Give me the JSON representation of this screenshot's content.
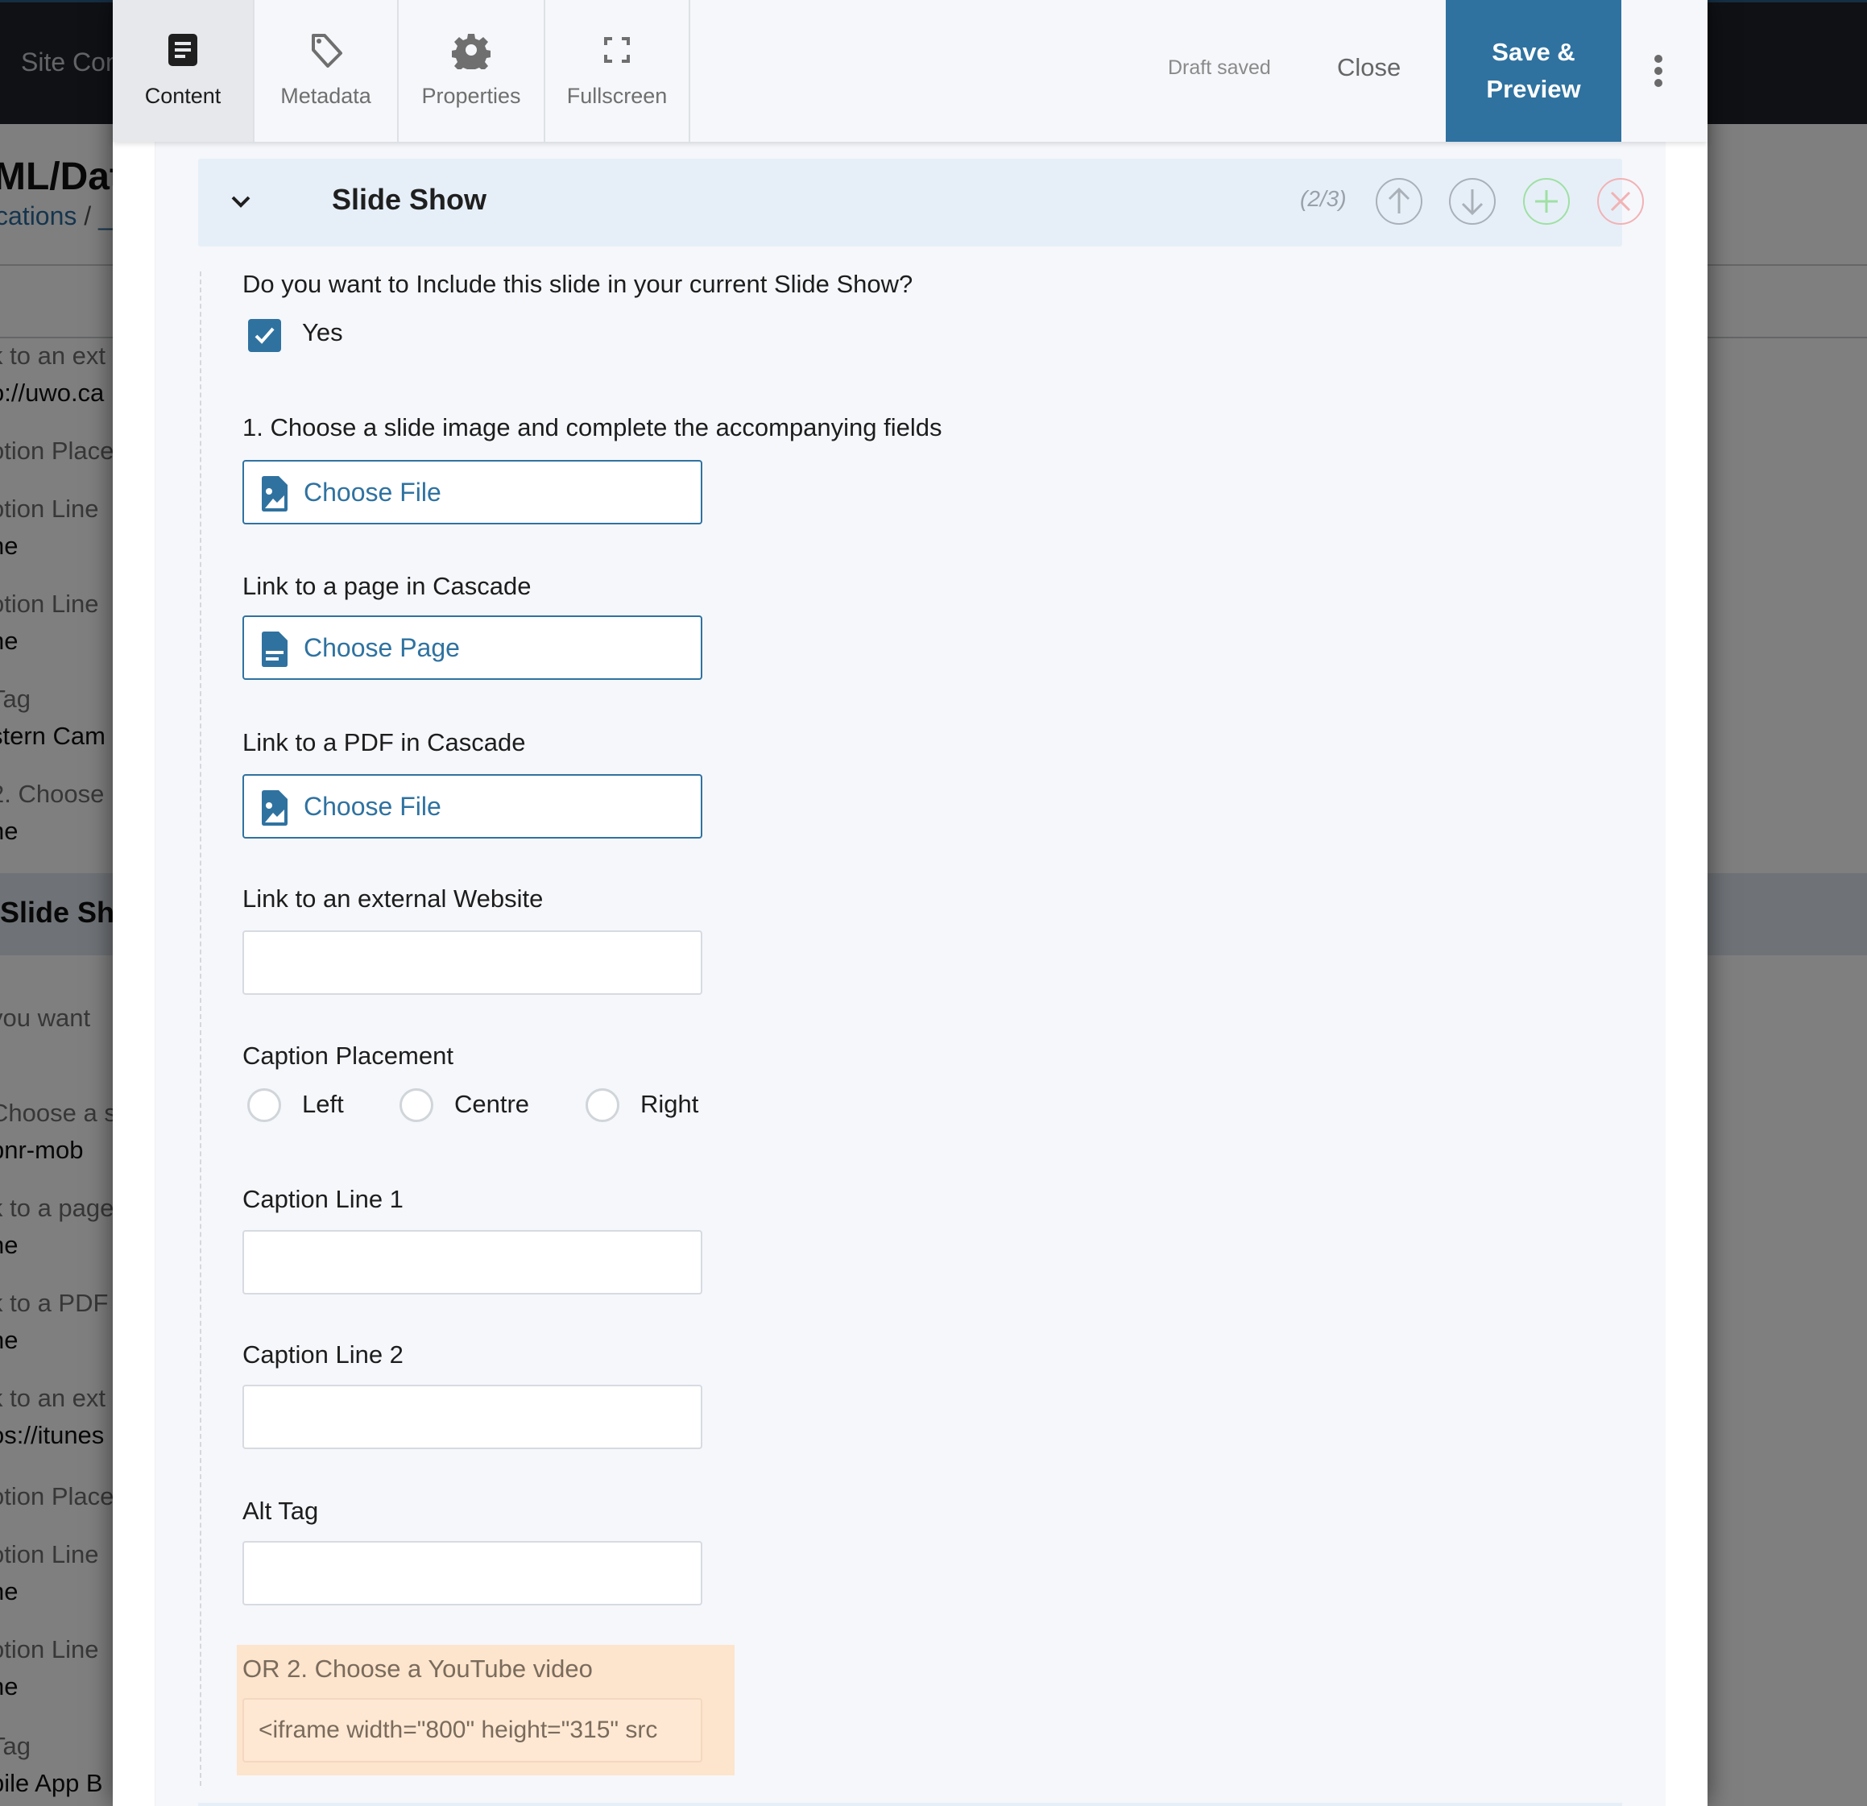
{
  "background_page": {
    "nav_label": "Site Con",
    "title": "ML/Dat",
    "breadcrumb": [
      "cations",
      "/",
      "_"
    ],
    "fields": [
      {
        "label": "k to an ext",
        "value": "o://uwo.ca"
      },
      {
        "label": "otion Place",
        "value": ""
      },
      {
        "label": "otion Line",
        "value": "ne"
      },
      {
        "label": "otion Line",
        "value": "ne"
      },
      {
        "label": "Tag",
        "value": "stern Cam"
      },
      {
        "label": "2. Choose",
        "value": "ne"
      }
    ],
    "section_title": "Slide Sho",
    "fields_2": [
      {
        "label": "you want",
        "value": ""
      },
      {
        "label": "Choose a s",
        "value": "bnr-mob"
      },
      {
        "label": "k to a page",
        "value": "ne"
      },
      {
        "label": "k to a PDF",
        "value": "ne"
      },
      {
        "label": "k to an ext",
        "value": "os://itunes"
      },
      {
        "label": "otion Place",
        "value": ""
      },
      {
        "label": "otion Line",
        "value": "ne"
      },
      {
        "label": "otion Line",
        "value": "ne"
      },
      {
        "label": "Tag",
        "value": "bile App B"
      }
    ]
  },
  "toolbar": {
    "tabs": [
      {
        "label": "Content",
        "icon": "content-icon",
        "active": true
      },
      {
        "label": "Metadata",
        "icon": "tag-icon",
        "active": false
      },
      {
        "label": "Properties",
        "icon": "gear-icon",
        "active": false
      },
      {
        "label": "Fullscreen",
        "icon": "fullscreen-icon",
        "active": false
      }
    ],
    "status": "Draft saved",
    "close_label": "Close",
    "save_label_line1": "Save &",
    "save_label_line2": "Preview",
    "more_icon": "kebab-icon"
  },
  "section": {
    "title": "Slide Show",
    "position": "(2/3)",
    "actions": [
      "move-up",
      "move-down",
      "add",
      "remove"
    ]
  },
  "form": {
    "include_question": "Do you want to Include this slide in your current Slide Show?",
    "include_option": "Yes",
    "include_checked": true,
    "image_label": "1. Choose a slide image and complete the accompanying fields",
    "image_button": "Choose File",
    "page_label": "Link to a page in Cascade",
    "page_button": "Choose Page",
    "pdf_label": "Link to a PDF in Cascade",
    "pdf_button": "Choose File",
    "external_label": "Link to an external Website",
    "external_value": "",
    "caption_placement_label": "Caption Placement",
    "caption_placement_options": [
      "Left",
      "Centre",
      "Right"
    ],
    "caption_placement_selected": null,
    "caption1_label": "Caption Line 1",
    "caption1_value": "",
    "caption2_label": "Caption Line 2",
    "caption2_value": "",
    "alt_label": "Alt Tag",
    "alt_value": "",
    "youtube_label": "OR 2. Choose a YouTube video",
    "youtube_value": "<iframe width=\"800\" height=\"315\" src"
  },
  "colors": {
    "accent": "#2f72a0",
    "section_header_bg": "#e6eff8",
    "youtube_highlight": "#fde4cc",
    "add_green": "#9fe0a3",
    "remove_red": "#f2b2b4"
  }
}
